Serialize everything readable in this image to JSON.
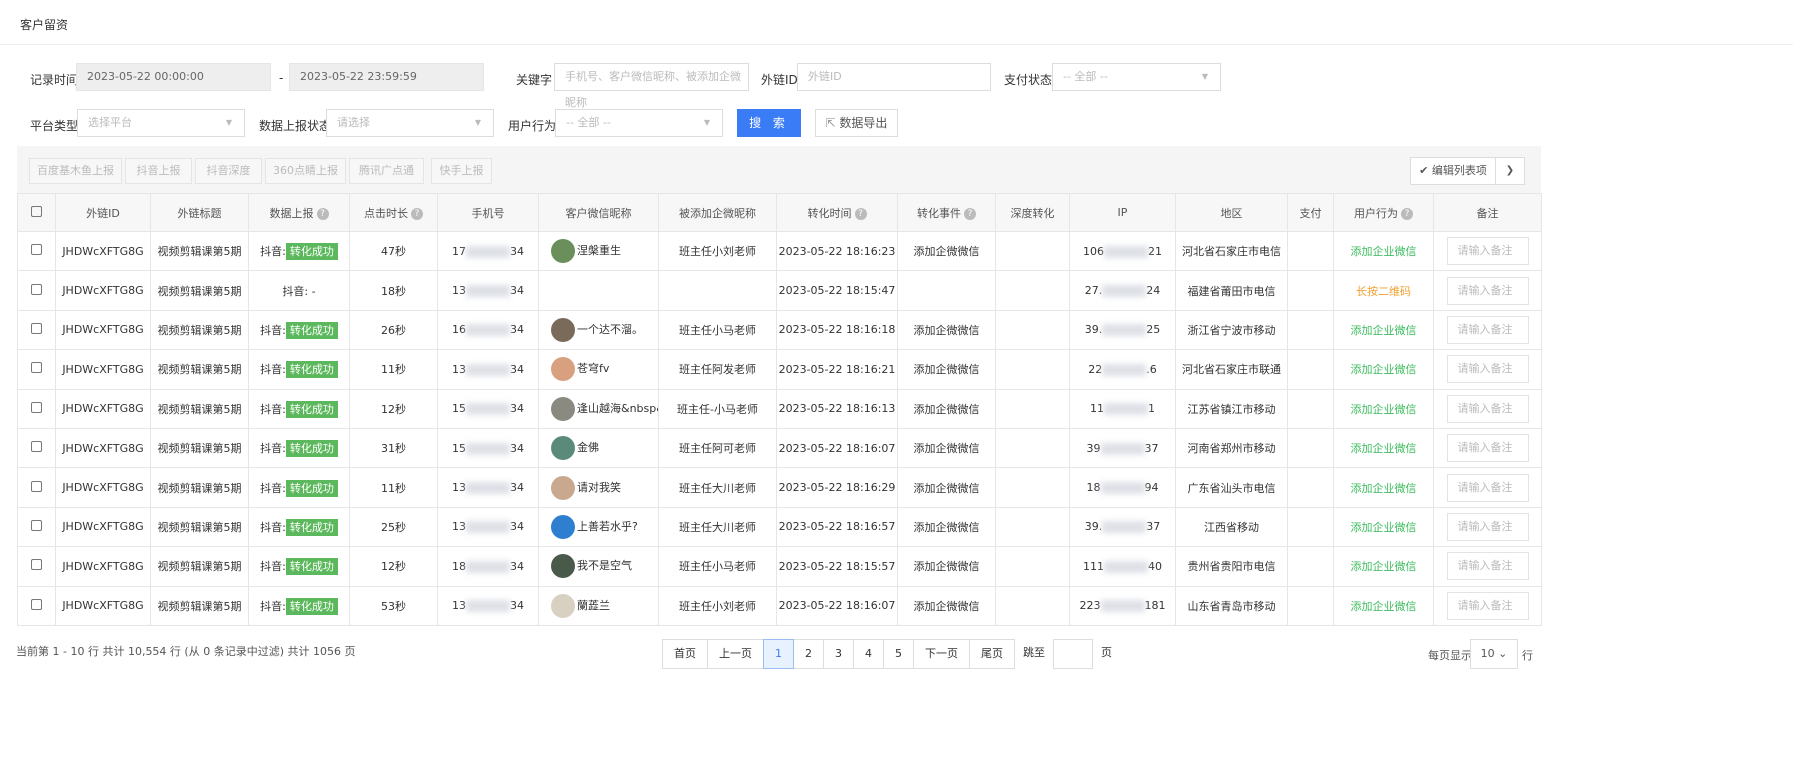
{
  "page_title": "客户留资",
  "filters": {
    "record_time_label": "记录时间",
    "start": "2023-05-22 00:00:00",
    "sep": "-",
    "end": "2023-05-22 23:59:59",
    "keyword_label": "关键字",
    "keyword_placeholder": "手机号、客户微信昵称、被添加企微昵称",
    "link_id_label": "外链ID",
    "link_id_placeholder": "外链ID",
    "pay_label": "支付状态",
    "pay_value": "-- 全部 --",
    "platform_label": "平台类型",
    "platform_placeholder": "选择平台",
    "report_label": "数据上报状态",
    "report_placeholder": "请选择",
    "behavior_label": "用户行为",
    "behavior_value": "-- 全部 --",
    "search": "搜 索",
    "export": "数据导出"
  },
  "toolbar": {
    "buttons": [
      "百度基木鱼上报",
      "抖音上报",
      "抖音深度",
      "360点睛上报",
      "腾讯广点通",
      "快手上报"
    ],
    "edit_columns": "编辑列表项"
  },
  "columns": [
    "外链ID",
    "外链标题",
    "数据上报",
    "点击时长",
    "手机号",
    "客户微信昵称",
    "被添加企微昵称",
    "转化时间",
    "转化事件",
    "深度转化",
    "IP",
    "地区",
    "支付",
    "用户行为",
    "备注"
  ],
  "note_placeholder": "请输入备注",
  "rows": [
    {
      "id": "JHDWcXFTG8G",
      "title": "视频剪辑课第5期",
      "report": "抖音:",
      "status": "转化成功",
      "dur": "47秒",
      "ph1": "17",
      "ph2": "34",
      "nick": "涅槃重生",
      "av": "#6a8f5a",
      "added": "班主任小刘老师",
      "time": "2023-05-22 18:16:23",
      "event": "添加企微微信",
      "ip1": "106",
      "ip2": "21",
      "region": "河北省石家庄市电信",
      "behavior": "添加企业微信",
      "bc": "green"
    },
    {
      "id": "JHDWcXFTG8G",
      "title": "视频剪辑课第5期",
      "report": "抖音: -",
      "status": "",
      "dur": "18秒",
      "ph1": "13",
      "ph2": "34",
      "nick": "",
      "av": "",
      "added": "",
      "time": "2023-05-22 18:15:47",
      "event": "",
      "ip1": "27.",
      "ip2": "24",
      "region": "福建省莆田市电信",
      "behavior": "长按二维码",
      "bc": "orange"
    },
    {
      "id": "JHDWcXFTG8G",
      "title": "视频剪辑课第5期",
      "report": "抖音:",
      "status": "转化成功",
      "dur": "26秒",
      "ph1": "16",
      "ph2": "34",
      "nick": "一个达不溜。",
      "av": "#7a6a5a",
      "added": "班主任小马老师",
      "time": "2023-05-22 18:16:18",
      "event": "添加企微微信",
      "ip1": "39.",
      "ip2": "25",
      "region": "浙江省宁波市移动",
      "behavior": "添加企业微信",
      "bc": "green"
    },
    {
      "id": "JHDWcXFTG8G",
      "title": "视频剪辑课第5期",
      "report": "抖音:",
      "status": "转化成功",
      "dur": "11秒",
      "ph1": "13",
      "ph2": "34",
      "nick": "苍穹fv",
      "av": "#d9a080",
      "added": "班主任阿发老师",
      "time": "2023-05-22 18:16:21",
      "event": "添加企微微信",
      "ip1": "22",
      "ip2": ".6",
      "region": "河北省石家庄市联通",
      "behavior": "添加企业微信",
      "bc": "green"
    },
    {
      "id": "JHDWcXFTG8G",
      "title": "视频剪辑课第5期",
      "report": "抖音:",
      "status": "转化成功",
      "dur": "12秒",
      "ph1": "15",
      "ph2": "34",
      "nick": "逢山越海&nbsp&nbsp",
      "av": "#8a8a80",
      "added": "班主任-小马老师",
      "time": "2023-05-22 18:16:13",
      "event": "添加企微微信",
      "ip1": "11",
      "ip2": "1",
      "region": "江苏省镇江市移动",
      "behavior": "添加企业微信",
      "bc": "green"
    },
    {
      "id": "JHDWcXFTG8G",
      "title": "视频剪辑课第5期",
      "report": "抖音:",
      "status": "转化成功",
      "dur": "31秒",
      "ph1": "15",
      "ph2": "34",
      "nick": "金佛",
      "av": "#5a8a7a",
      "added": "班主任阿可老师",
      "time": "2023-05-22 18:16:07",
      "event": "添加企微微信",
      "ip1": "39",
      "ip2": "37",
      "region": "河南省郑州市移动",
      "behavior": "添加企业微信",
      "bc": "green"
    },
    {
      "id": "JHDWcXFTG8G",
      "title": "视频剪辑课第5期",
      "report": "抖音:",
      "status": "转化成功",
      "dur": "11秒",
      "ph1": "13",
      "ph2": "34",
      "nick": "请对我笑",
      "av": "#c9a890",
      "added": "班主任大川老师",
      "time": "2023-05-22 18:16:29",
      "event": "添加企微微信",
      "ip1": "18",
      "ip2": "94",
      "region": "广东省汕头市电信",
      "behavior": "添加企业微信",
      "bc": "green"
    },
    {
      "id": "JHDWcXFTG8G",
      "title": "视频剪辑课第5期",
      "report": "抖音:",
      "status": "转化成功",
      "dur": "25秒",
      "ph1": "13",
      "ph2": "34",
      "nick": "上善若水乎?",
      "av": "#2f7fd0",
      "added": "班主任大川老师",
      "time": "2023-05-22 18:16:57",
      "event": "添加企微微信",
      "ip1": "39.",
      "ip2": "37",
      "region": "江西省移动",
      "behavior": "添加企业微信",
      "bc": "green"
    },
    {
      "id": "JHDWcXFTG8G",
      "title": "视频剪辑课第5期",
      "report": "抖音:",
      "status": "转化成功",
      "dur": "12秒",
      "ph1": "18",
      "ph2": "34",
      "nick": "我不是空气",
      "av": "#4a5a4a",
      "added": "班主任小马老师",
      "time": "2023-05-22 18:15:57",
      "event": "添加企微微信",
      "ip1": "111",
      "ip2": "40",
      "region": "贵州省贵阳市电信",
      "behavior": "添加企业微信",
      "bc": "green"
    },
    {
      "id": "JHDWcXFTG8G",
      "title": "视频剪辑课第5期",
      "report": "抖音:",
      "status": "转化成功",
      "dur": "53秒",
      "ph1": "13",
      "ph2": "34",
      "nick": "蘭蕋兰",
      "av": "#d8d0c0",
      "added": "班主任小刘老师",
      "time": "2023-05-22 18:16:07",
      "event": "添加企微微信",
      "ip1": "223",
      "ip2": "181",
      "region": "山东省青岛市移动",
      "behavior": "添加企业微信",
      "bc": "green"
    }
  ],
  "footer": {
    "info": "当前第 1 - 10 行   共计 10,554 行 (从 0 条记录中过滤)   共计 1056 页",
    "first": "首页",
    "prev": "上一页",
    "pages": [
      "1",
      "2",
      "3",
      "4",
      "5"
    ],
    "next": "下一页",
    "last": "尾页",
    "goto": "跳至",
    "page_unit": "页",
    "per_page_label": "每页显示",
    "per_page": "10",
    "row_unit": "行"
  }
}
